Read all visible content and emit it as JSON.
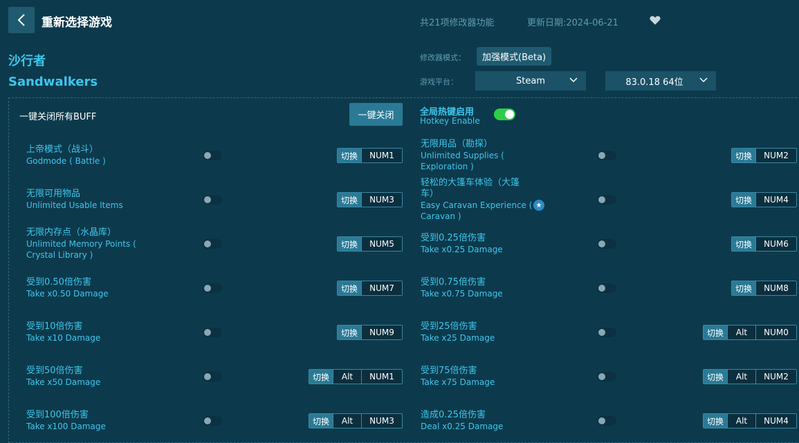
{
  "header": {
    "back_icon": "chevron-left-icon",
    "title": "重新选择游戏",
    "feature_count": "共21项修改器功能",
    "update_date": "更新日期:2024-06-21",
    "favorite_icon": "heart-icon"
  },
  "game": {
    "name_cn": "沙行者",
    "name_en": "Sandwalkers"
  },
  "settings": {
    "mode_label": "修改器模式：",
    "mode_value": "加强模式(Beta)",
    "platform_label": "游戏平台：",
    "platform_value": "Steam",
    "version_value": "83.0.18 64位"
  },
  "controls": {
    "buff_label": "一键关闭所有BUFF",
    "close_all_button": "一键关闭",
    "hotkey_cn": "全局热键启用",
    "hotkey_en": "Hotkey Enable",
    "hotkey_enabled": true
  },
  "switch_label": "切换",
  "colors": {
    "background": "#0c3a4c",
    "accent": "#3fc5ec",
    "toggle_on": "#2ecc47"
  },
  "features": [
    {
      "cn": "上帝模式（战斗）",
      "en": [
        "Godmode ( Battle )"
      ],
      "keys": [
        "NUM1"
      ],
      "on": false
    },
    {
      "cn": "无限用品（勘探）",
      "en": [
        "Unlimited Supplies (",
        "Exploration )"
      ],
      "keys": [
        "NUM2"
      ],
      "on": false
    },
    {
      "cn": "无限可用物品",
      "en": [
        "Unlimited Usable Items"
      ],
      "keys": [
        "NUM3"
      ],
      "on": false
    },
    {
      "cn": "轻松的大篷车体验（大篷",
      "cn2": "车）",
      "en": [
        "Easy Caravan Experience (",
        "Caravan )"
      ],
      "keys": [
        "NUM4"
      ],
      "on": false,
      "star": true
    },
    {
      "cn": "无限内存点（水晶库）",
      "en": [
        "Unlimited Memory Points (",
        "Crystal Library )"
      ],
      "keys": [
        "NUM5"
      ],
      "on": false
    },
    {
      "cn": "受到0.25倍伤害",
      "en": [
        "Take x0.25 Damage"
      ],
      "keys": [
        "NUM6"
      ],
      "on": false
    },
    {
      "cn": "受到0.50倍伤害",
      "en": [
        "Take x0.50 Damage"
      ],
      "keys": [
        "NUM7"
      ],
      "on": false
    },
    {
      "cn": "受到0.75倍伤害",
      "en": [
        "Take x0.75 Damage"
      ],
      "keys": [
        "NUM8"
      ],
      "on": false
    },
    {
      "cn": "受到10倍伤害",
      "en": [
        "Take x10 Damage"
      ],
      "keys": [
        "NUM9"
      ],
      "on": false
    },
    {
      "cn": "受到25倍伤害",
      "en": [
        "Take x25 Damage"
      ],
      "keys": [
        "Alt",
        "NUM0"
      ],
      "on": false
    },
    {
      "cn": "受到50倍伤害",
      "en": [
        "Take x50 Damage"
      ],
      "keys": [
        "Alt",
        "NUM1"
      ],
      "on": false
    },
    {
      "cn": "受到75倍伤害",
      "en": [
        "Take x75 Damage"
      ],
      "keys": [
        "Alt",
        "NUM2"
      ],
      "on": false
    },
    {
      "cn": "受到100倍伤害",
      "en": [
        "Take x100 Damage"
      ],
      "keys": [
        "Alt",
        "NUM3"
      ],
      "on": false
    },
    {
      "cn": "造成0.25倍伤害",
      "en": [
        "Deal x0.25 Damage"
      ],
      "keys": [
        "Alt",
        "NUM4"
      ],
      "on": false
    }
  ]
}
